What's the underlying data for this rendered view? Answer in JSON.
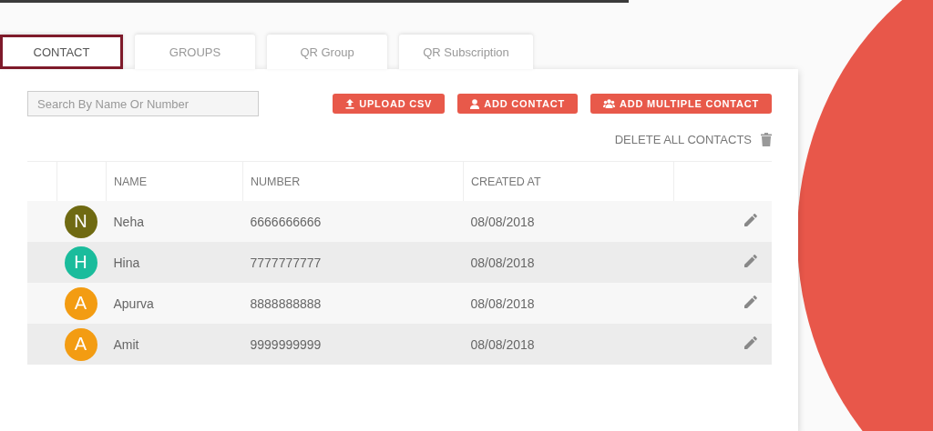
{
  "tabs": [
    {
      "label": "CONTACT",
      "selected": true
    },
    {
      "label": "GROUPS",
      "selected": false
    },
    {
      "label": "QR Group",
      "selected": false
    },
    {
      "label": "QR Subscription",
      "selected": false
    }
  ],
  "search": {
    "placeholder": "Search By Name Or Number"
  },
  "buttons": [
    {
      "label": "UPLOAD CSV",
      "kind": "upload"
    },
    {
      "label": "ADD CONTACT",
      "kind": "person"
    },
    {
      "label": "ADD MULTIPLE CONTACT",
      "kind": "group"
    }
  ],
  "delete_all": {
    "label": "DELETE ALL CONTACTS"
  },
  "table": {
    "columns": [
      "NAME",
      "NUMBER",
      "CREATED AT"
    ],
    "rows": [
      {
        "initial": "N",
        "color": "#6f6a12",
        "name": "Neha",
        "number": "6666666666",
        "created_at": "08/08/2018"
      },
      {
        "initial": "H",
        "color": "#1abc9c",
        "name": "Hina",
        "number": "7777777777",
        "created_at": "08/08/2018"
      },
      {
        "initial": "A",
        "color": "#f39c12",
        "name": "Apurva",
        "number": "8888888888",
        "created_at": "08/08/2018"
      },
      {
        "initial": "A",
        "color": "#f39c12",
        "name": "Amit",
        "number": "9999999999",
        "created_at": "08/08/2018"
      }
    ]
  }
}
